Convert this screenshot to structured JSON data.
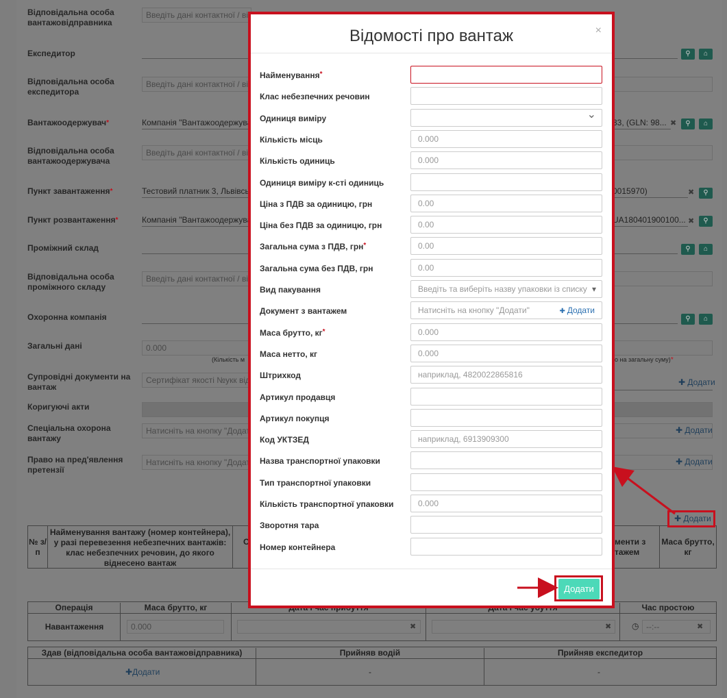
{
  "background": {
    "labels": {
      "resp_shipper": "Відповідальна особа вантажовідправника",
      "forwarder": "Експедитор",
      "resp_forwarder": "Відповідальна особа експедитора",
      "consignee": "Вантажоодержувач",
      "resp_consignee": "Відповідальна особа вантажоодержувача",
      "loading_point": "Пункт завантаження",
      "unloading_point": "Пункт розвантаження",
      "intermediate_warehouse": "Проміжний склад",
      "resp_warehouse": "Відповідальна особа проміжного складу",
      "security_company": "Охоронна компанія",
      "general_data": "Загальні дані",
      "accompanying_docs": "Супровідні документи на вантаж",
      "correcting_acts": "Коригуючі акти",
      "special_security": "Спеціальна охорона вантажу",
      "claim_right": "Право на пред'явлення претензії"
    },
    "values": {
      "resp_shipper": "Введіть дані контактної / від",
      "resp_forwarder": "Введіть дані контактної / від",
      "consignee_left": "Компанія \"Вантажоодержувач",
      "consignee_right": "33, (GLN: 98...",
      "resp_consignee": "Введіть дані контактної / від",
      "loading_left": "Тестовий платник 3, Львівськ",
      "loading_right": "0015970)",
      "unloading_left": "Компанія \"Вантажоодержувач",
      "unloading_right": "UA180401900100...",
      "resp_warehouse": "Введіть дані контактної / від",
      "general_data": "0.000",
      "general_note_left": "(Кількість м",
      "general_note_right": "о на загальну суму)",
      "accompanying_docs": "Сертифікат якості №укк від 2",
      "special_security": "Натисніть на кнопку \"Додати",
      "claim_right": "Натисніть на кнопку \"Додати"
    },
    "add_label": "Додати",
    "cargo_table": {
      "col_num": "№ з/п",
      "col_name": "Найменування вантажу (номер контейнера), у разі перевезення небезпечних вантажів: клас небезпечних речовин, до якого віднесено вантаж",
      "col_partial_left": "О",
      "col_partial_right": "менти з тажем",
      "col_gross": "Маса брутто, кг"
    },
    "ops_table": {
      "col_operation": "Операція",
      "col_gross": "Маса брутто, кг",
      "col_arrival": "Дата і час прибуття",
      "col_departure": "Дата і час убуття",
      "col_idle": "Час простою",
      "row_operation": "Навантаження",
      "row_gross": "0.000",
      "row_idle": "--:--"
    },
    "sign_table": {
      "col_handed": "Здав (відповідальна особа вантажовідправника)",
      "col_driver": "Прийняв водій",
      "col_forwarder": "Прийняв експедитор",
      "handed_add": "Додати",
      "driver_val": "-",
      "forwarder_val": "-"
    }
  },
  "modal": {
    "title": "Відомості про вантаж",
    "close": "×",
    "submit": "Додати",
    "fields": [
      {
        "label": "Найменування",
        "required": true,
        "placeholder": "",
        "type": "text",
        "error": true
      },
      {
        "label": "Клас небезпечних речовин",
        "required": false,
        "placeholder": "",
        "type": "text"
      },
      {
        "label": "Одиниця виміру",
        "required": false,
        "placeholder": "",
        "type": "select"
      },
      {
        "label": "Кількість місць",
        "required": false,
        "placeholder": "0.000",
        "type": "text"
      },
      {
        "label": "Кількість одиниць",
        "required": false,
        "placeholder": "0.000",
        "type": "text"
      },
      {
        "label": "Одиниця виміру к-сті одиниць",
        "required": false,
        "placeholder": "",
        "type": "text"
      },
      {
        "label": "Ціна з ПДВ за одиницю, грн",
        "required": false,
        "placeholder": "0.00",
        "type": "text"
      },
      {
        "label": "Ціна без ПДВ за одиницю, грн",
        "required": false,
        "placeholder": "0.00",
        "type": "text"
      },
      {
        "label": "Загальна сума з ПДВ, грн",
        "required": true,
        "placeholder": "0.00",
        "type": "text"
      },
      {
        "label": "Загальна сума без ПДВ, грн",
        "required": false,
        "placeholder": "0.00",
        "type": "text"
      },
      {
        "label": "Вид пакування",
        "required": false,
        "placeholder": "Введіть та виберіть назву упаковки із списку",
        "type": "select2"
      },
      {
        "label": "Документ з вантажем",
        "required": false,
        "placeholder": "Натисніть на кнопку \"Додати\"",
        "type": "add",
        "add_label": "Додати"
      },
      {
        "label": "Маса брутто, кг",
        "required": true,
        "placeholder": "0.000",
        "type": "text"
      },
      {
        "label": "Маса нетто, кг",
        "required": false,
        "placeholder": "0.000",
        "type": "text"
      },
      {
        "label": "Штрихкод",
        "required": false,
        "placeholder": "наприклад, 4820022865816",
        "type": "text"
      },
      {
        "label": "Артикул продавця",
        "required": false,
        "placeholder": "",
        "type": "text"
      },
      {
        "label": "Артикул покупця",
        "required": false,
        "placeholder": "",
        "type": "text"
      },
      {
        "label": "Код УКТЗЕД",
        "required": false,
        "placeholder": "наприклад, 6913909300",
        "type": "text"
      },
      {
        "label": "Назва транспортної упаковки",
        "required": false,
        "placeholder": "",
        "type": "text"
      },
      {
        "label": "Тип транспортної упаковки",
        "required": false,
        "placeholder": "",
        "type": "text"
      },
      {
        "label": "Кількість транспортної упаковки",
        "required": false,
        "placeholder": "0.000",
        "type": "text"
      },
      {
        "label": "Зворотня тара",
        "required": false,
        "placeholder": "",
        "type": "text"
      },
      {
        "label": "Номер контейнера",
        "required": false,
        "placeholder": "",
        "type": "text"
      }
    ]
  },
  "colors": {
    "highlight": "#c8101e",
    "submit": "#4cd9b8",
    "icon_button": "#1f5a4e"
  }
}
